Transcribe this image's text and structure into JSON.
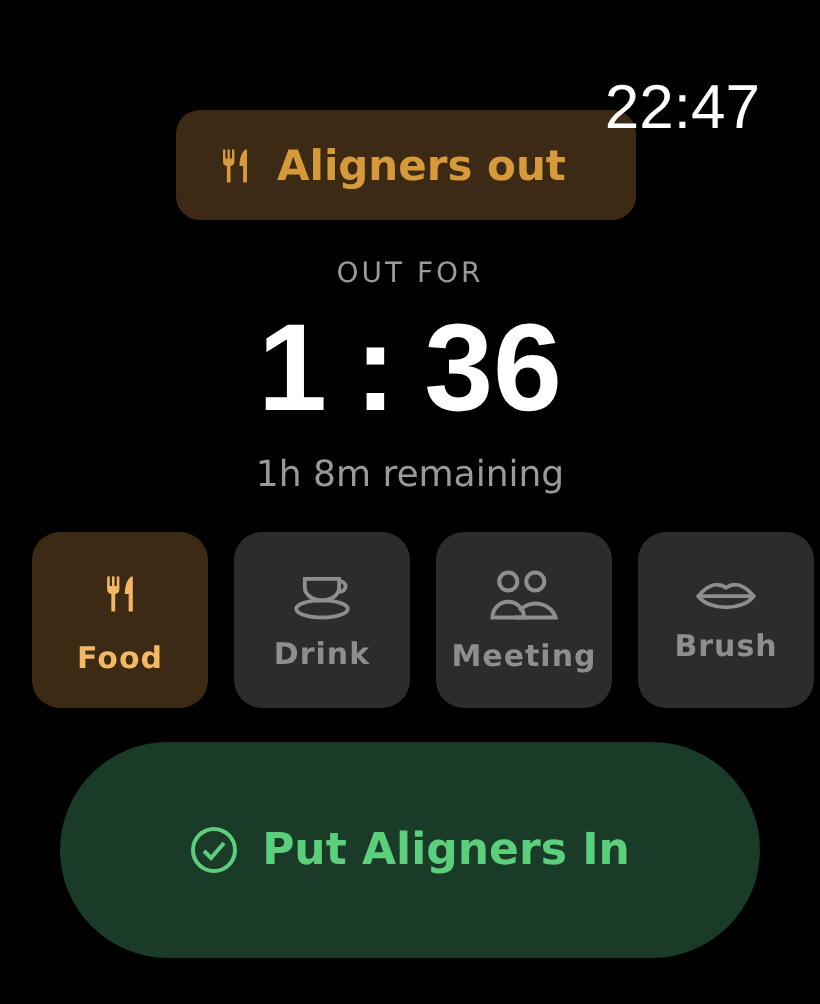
{
  "clock": "22:47",
  "status_pill": {
    "label": "Aligners out"
  },
  "timer": {
    "caption": "OUT FOR",
    "hours": "1",
    "separator": ":",
    "minutes": "36",
    "remaining": "1h 8m remaining"
  },
  "activities": [
    {
      "kind": "food",
      "label": "Food",
      "selected": true
    },
    {
      "kind": "drink",
      "label": "Drink",
      "selected": false
    },
    {
      "kind": "meeting",
      "label": "Meeting",
      "selected": false
    },
    {
      "kind": "brush",
      "label": "Brush",
      "selected": false
    }
  ],
  "action_button": {
    "label": "Put Aligners In"
  }
}
